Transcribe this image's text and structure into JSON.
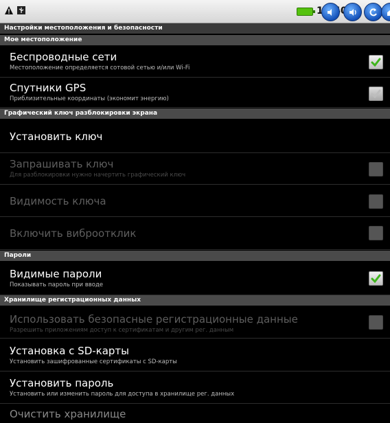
{
  "status_bar": {
    "time": "13:40",
    "icons": [
      "warning-icon",
      "usb-icon",
      "battery-icon",
      "volume-down-icon",
      "volume-up-icon",
      "back-icon",
      "home-icon"
    ]
  },
  "screen_title": "Настройки местоположения и безопасности",
  "sections": {
    "location": "Мое местоположение",
    "pattern": "Графический ключ разблокировки экрана",
    "passwords": "Пароли",
    "credentials": "Хранилище регистрационных данных"
  },
  "items": {
    "wireless": {
      "title": "Беспроводные сети",
      "summary": "Местоположение определяется сотовой сетью и/или Wi-Fi",
      "checked": true
    },
    "gps": {
      "title": "Спутники GPS",
      "summary": "Приблизительные координаты (экономит энергию)",
      "checked": true
    },
    "set_pattern": {
      "title": "Установить ключ"
    },
    "require_pattern": {
      "title": "Запрашивать ключ",
      "summary": "Для разблокировки нужно начертить графический ключ",
      "checked": false
    },
    "visible_pattern": {
      "title": "Видимость ключа",
      "checked": false
    },
    "tactile": {
      "title": "Включить виброотклик",
      "checked": false
    },
    "visible_passwords": {
      "title": "Видимые пароли",
      "summary": "Показывать пароль при вводе",
      "checked": true
    },
    "use_credentials": {
      "title": "Использовать безопасные регистрационные данные",
      "summary": "Разрешить приложениям доступ к сертификатам и другим рег. данным",
      "checked": false
    },
    "install_sd": {
      "title": "Установка с SD-карты",
      "summary": "Установить зашифрованные сертификаты с SD-карты"
    },
    "set_password": {
      "title": "Установить пароль",
      "summary": "Установить или изменить пароль для доступа в хранилище рег. данных"
    },
    "clear_storage": {
      "title": "Очистить хранилище"
    }
  }
}
